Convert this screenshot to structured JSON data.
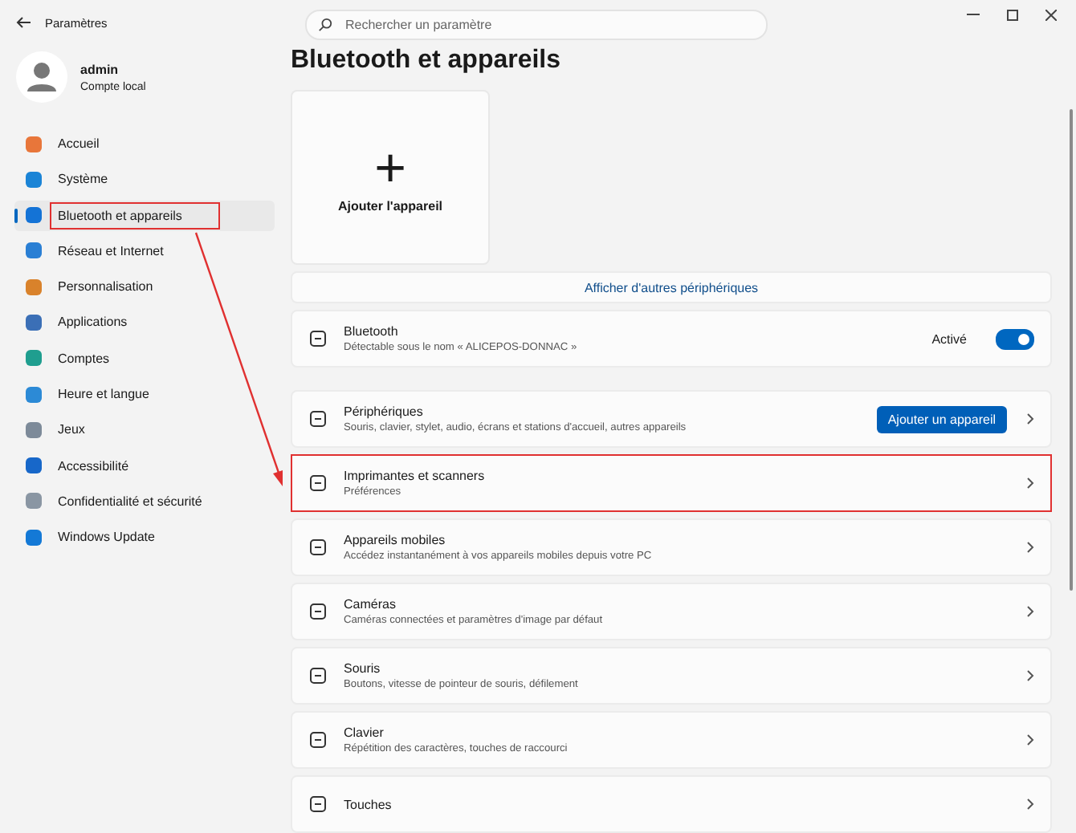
{
  "window": {
    "title": "Paramètres"
  },
  "search": {
    "placeholder": "Rechercher un paramètre"
  },
  "user": {
    "name": "admin",
    "account": "Compte local"
  },
  "sidebar": {
    "items": [
      {
        "label": "Accueil",
        "selected": false,
        "annotated": false
      },
      {
        "label": "Système",
        "selected": false,
        "annotated": false
      },
      {
        "label": "Bluetooth et appareils",
        "selected": true,
        "annotated": true
      },
      {
        "label": "Réseau et Internet",
        "selected": false,
        "annotated": false
      },
      {
        "label": "Personnalisation",
        "selected": false,
        "annotated": false
      },
      {
        "label": "Applications",
        "selected": false,
        "annotated": false
      },
      {
        "label": "Comptes",
        "selected": false,
        "annotated": false
      },
      {
        "label": "Heure et langue",
        "selected": false,
        "annotated": false
      },
      {
        "label": "Jeux",
        "selected": false,
        "annotated": false
      },
      {
        "label": "Accessibilité",
        "selected": false,
        "annotated": false
      },
      {
        "label": "Confidentialité et sécurité",
        "selected": false,
        "annotated": false
      },
      {
        "label": "Windows Update",
        "selected": false,
        "annotated": false
      }
    ]
  },
  "page": {
    "title": "Bluetooth et appareils",
    "add_tile": {
      "label": "Ajouter l'appareil",
      "symbol": "+"
    },
    "more_link": "Afficher d'autres périphériques",
    "rows": [
      {
        "kind": "toggle",
        "title": "Bluetooth",
        "subtitle": "Détectable sous le nom « ALICEPOS-DONNAC »",
        "status": "Activé",
        "on": true,
        "annotated": false
      },
      {
        "kind": "button",
        "title": "Périphériques",
        "subtitle": "Souris, clavier, stylet, audio, écrans et stations d'accueil, autres appareils",
        "button": "Ajouter un appareil",
        "annotated": false
      },
      {
        "kind": "link",
        "title": "Imprimantes et scanners",
        "subtitle": "Préférences",
        "annotated": true
      },
      {
        "kind": "link",
        "title": "Appareils mobiles",
        "subtitle": "Accédez instantanément à vos appareils mobiles depuis votre PC",
        "annotated": false
      },
      {
        "kind": "link",
        "title": "Caméras",
        "subtitle": "Caméras connectées et paramètres d'image par défaut",
        "annotated": false
      },
      {
        "kind": "link",
        "title": "Souris",
        "subtitle": "Boutons, vitesse de pointeur de souris, défilement",
        "annotated": false
      },
      {
        "kind": "link",
        "title": "Clavier",
        "subtitle": "Répétition des caractères, touches de raccourci",
        "annotated": false
      },
      {
        "kind": "link",
        "title": "Touches",
        "annotated": false
      }
    ]
  }
}
